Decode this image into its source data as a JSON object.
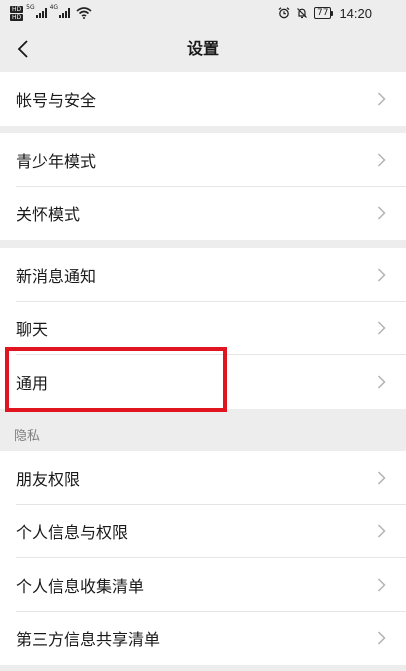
{
  "status_bar": {
    "hd_top": "HD",
    "hd_bottom": "HD",
    "network_1": "5G",
    "network_2": "4G",
    "battery": "77",
    "time": "14:20"
  },
  "nav": {
    "title": "设置"
  },
  "groups": [
    {
      "items": [
        {
          "label": "帐号与安全"
        }
      ]
    },
    {
      "items": [
        {
          "label": "青少年模式"
        },
        {
          "label": "关怀模式"
        }
      ]
    },
    {
      "items": [
        {
          "label": "新消息通知"
        },
        {
          "label": "聊天"
        },
        {
          "label": "通用"
        }
      ]
    },
    {
      "header": "隐私",
      "items": [
        {
          "label": "朋友权限"
        },
        {
          "label": "个人信息与权限"
        },
        {
          "label": "个人信息收集清单"
        },
        {
          "label": "第三方信息共享清单"
        }
      ]
    }
  ],
  "colors": {
    "background": "#ededed",
    "highlight": "#e0151f"
  }
}
